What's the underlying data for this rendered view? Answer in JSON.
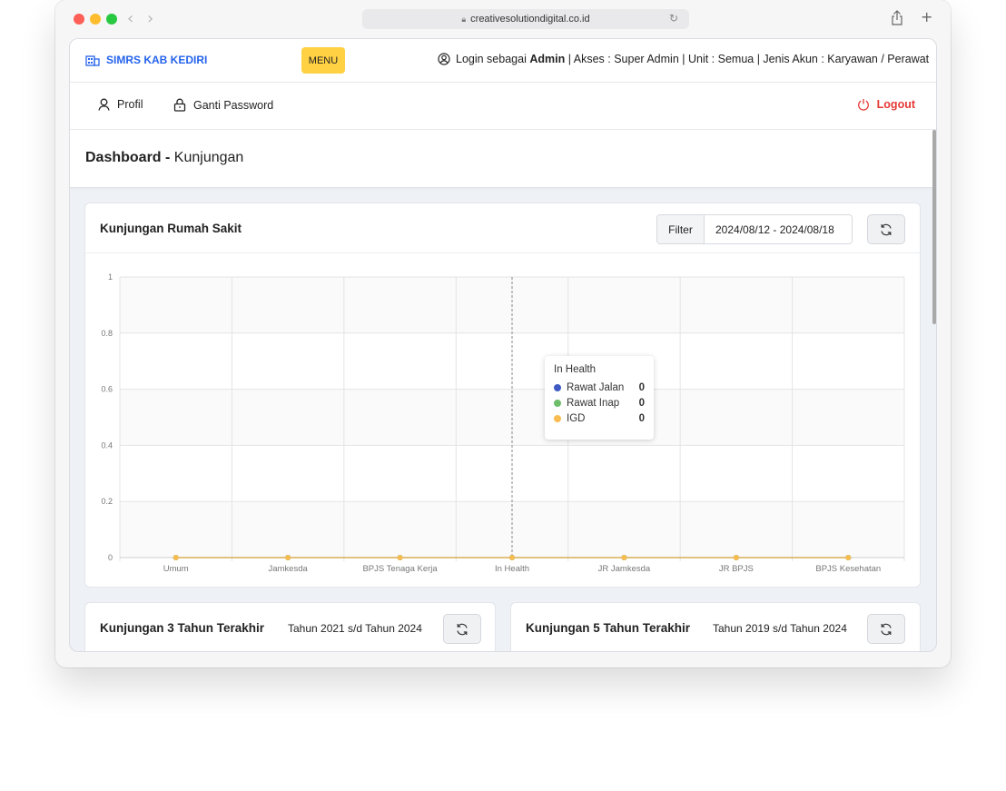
{
  "browser": {
    "url": "creativesolutiondigital.co.id"
  },
  "header": {
    "brand": "SIMRS KAB KEDIRI",
    "menu_label": "MENU",
    "login_prefix": "Login sebagai",
    "login_user": "Admin",
    "login_rest": "| Akses : Super Admin | Unit : Semua | Jenis Akun : Karyawan / Perawat"
  },
  "nav": {
    "profile": "Profil",
    "change_password": "Ganti Password",
    "logout": "Logout"
  },
  "page": {
    "title_bold": "Dashboard -",
    "title_rest": "Kunjungan"
  },
  "main_card": {
    "title": "Kunjungan Rumah Sakit",
    "filter_label": "Filter",
    "filter_value": "2024/08/12 - 2024/08/18"
  },
  "chart_data": {
    "type": "line",
    "categories": [
      "Umum",
      "Jamkesda",
      "BPJS Tenaga Kerja",
      "In Health",
      "JR Jamkesda",
      "JR BPJS",
      "BPJS Kesehatan"
    ],
    "series": [
      {
        "name": "Rawat Jalan",
        "color": "#3f5ac4",
        "values": [
          0,
          0,
          0,
          0,
          0,
          0,
          0
        ]
      },
      {
        "name": "Rawat Inap",
        "color": "#6dbe6a",
        "values": [
          0,
          0,
          0,
          0,
          0,
          0,
          0
        ]
      },
      {
        "name": "IGD",
        "color": "#f9bc51",
        "values": [
          0,
          0,
          0,
          0,
          0,
          0,
          0
        ]
      }
    ],
    "ylim": [
      0,
      1
    ],
    "yticks": [
      "0",
      "0.2",
      "0.4",
      "0.6",
      "0.8",
      "1"
    ],
    "grid": true,
    "tooltip": {
      "category": "In Health",
      "rows": [
        {
          "name": "Rawat Jalan",
          "value": "0",
          "color": "#3f5ac4"
        },
        {
          "name": "Rawat Inap",
          "value": "0",
          "color": "#6dbe6a"
        },
        {
          "name": "IGD",
          "value": "0",
          "color": "#f9bc51"
        }
      ]
    }
  },
  "bottom_cards": [
    {
      "title": "Kunjungan 3 Tahun Terakhir",
      "subtitle": "Tahun 2021 s/d Tahun 2024"
    },
    {
      "title": "Kunjungan 5 Tahun Terakhir",
      "subtitle": "Tahun 2019 s/d Tahun 2024"
    }
  ]
}
